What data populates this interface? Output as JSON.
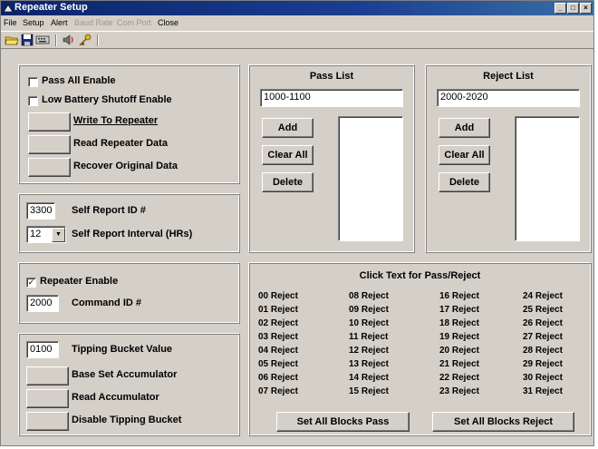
{
  "window": {
    "title": "Repeater Setup",
    "title_icon": "antenna-icon",
    "controls": [
      "_",
      "□",
      "×"
    ]
  },
  "menu": [
    {
      "label": "File",
      "enabled": true
    },
    {
      "label": "Setup",
      "enabled": true
    },
    {
      "label": "Alert",
      "enabled": true
    },
    {
      "label": "Baud Rate",
      "enabled": false
    },
    {
      "label": "Com Port",
      "enabled": false
    },
    {
      "label": "Close",
      "enabled": true
    }
  ],
  "toolbar": {
    "icons": [
      "open-folder-icon",
      "save-disk-icon",
      "keyboard-icon",
      "speaker-icon",
      "key-icon"
    ]
  },
  "settings": {
    "pass_all": {
      "label": "Pass All Enable",
      "checked": false
    },
    "low_battery": {
      "label": "Low Battery Shutoff Enable",
      "checked": false
    },
    "write_label": "Write To Repeater",
    "read_label": "Read Repeater Data",
    "recover_label": "Recover Original Data"
  },
  "self_report": {
    "id_value": "3300",
    "id_label": "Self Report ID #",
    "interval_value": "12",
    "interval_label": "Self Report Interval (HRs)"
  },
  "repeater": {
    "enable_label": "Repeater Enable",
    "enable_checked": true,
    "command_value": "2000",
    "command_label": "Command ID #"
  },
  "tipping": {
    "value": "0100",
    "value_label": "Tipping Bucket Value",
    "base_label": "Base Set Accumulator",
    "read_label": "Read Accumulator",
    "disable_label": "Disable Tipping Bucket"
  },
  "pass_list": {
    "title": "Pass List",
    "value": "1000-1100",
    "add": "Add",
    "clear": "Clear All",
    "delete": "Delete"
  },
  "reject_list": {
    "title": "Reject List",
    "value": "2000-2020",
    "add": "Add",
    "clear": "Clear All",
    "delete": "Delete"
  },
  "blocks": {
    "title": "Click Text for Pass/Reject",
    "columns": [
      [
        "00 Reject",
        "01 Reject",
        "02 Reject",
        "03 Reject",
        "04 Reject",
        "05 Reject",
        "06 Reject",
        "07 Reject"
      ],
      [
        "08 Reject",
        "09 Reject",
        "10 Reject",
        "11 Reject",
        "12 Reject",
        "13 Reject",
        "14 Reject",
        "15 Reject"
      ],
      [
        "16 Reject",
        "17 Reject",
        "18 Reject",
        "19 Reject",
        "20 Reject",
        "21 Reject",
        "22 Reject",
        "23 Reject"
      ],
      [
        "24 Reject",
        "25 Reject",
        "26 Reject",
        "27 Reject",
        "28 Reject",
        "29 Reject",
        "30 Reject",
        "31 Reject"
      ]
    ],
    "set_pass": "Set All Blocks Pass",
    "set_reject": "Set All Blocks Reject"
  }
}
